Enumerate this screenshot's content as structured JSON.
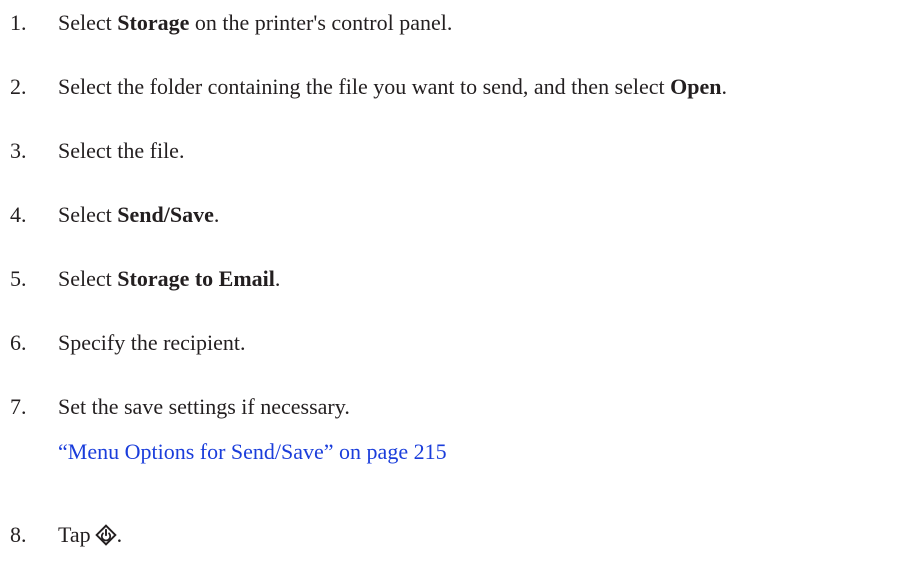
{
  "steps": [
    {
      "number": "1.",
      "before": "Select ",
      "bold": "Storage",
      "after": " on the printer's control panel."
    },
    {
      "number": "2.",
      "before": "Select the folder containing the file you want to send, and then select ",
      "bold": "Open",
      "after": "."
    },
    {
      "number": "3.",
      "text": "Select the file."
    },
    {
      "number": "4.",
      "before": "Select ",
      "bold": "Send/Save",
      "after": "."
    },
    {
      "number": "5.",
      "before": "Select ",
      "bold": "Storage to Email",
      "after": "."
    },
    {
      "number": "6.",
      "text": "Specify the recipient."
    },
    {
      "number": "7.",
      "text": "Set the save settings if necessary.",
      "link": "“Menu Options for Send/Save” on page 215"
    },
    {
      "number": "8.",
      "before": "Tap",
      "icon": "start-icon",
      "after": "."
    }
  ],
  "colors": {
    "text": "#231f20",
    "link": "#1a3ddb"
  }
}
